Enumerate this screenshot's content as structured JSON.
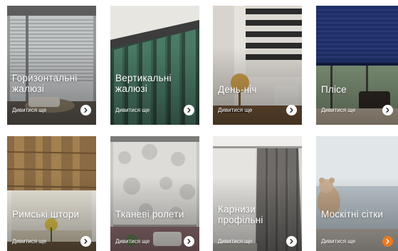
{
  "cards": [
    {
      "title": "Горизонтальні жалюзі",
      "more_label": "Дивитися ще"
    },
    {
      "title": "Вертикальні жалюзі",
      "more_label": "Дивитися ще"
    },
    {
      "title": "День-ніч",
      "more_label": "Дивитися ще"
    },
    {
      "title": "Плісе",
      "more_label": "Дивитися ще"
    },
    {
      "title": "Римські штори",
      "more_label": "Дивитися ще"
    },
    {
      "title": "Тканеві ролети",
      "more_label": "Дивитися ще"
    },
    {
      "title": "Карнизи профільні",
      "more_label": "Дивитися ще"
    },
    {
      "title": "Москітні сітки",
      "more_label": "Дивитися ще"
    }
  ],
  "colors": {
    "accent": "#ee7a22",
    "arrow": "#222222"
  },
  "icons": {
    "arrow": "chevron-right-icon"
  }
}
